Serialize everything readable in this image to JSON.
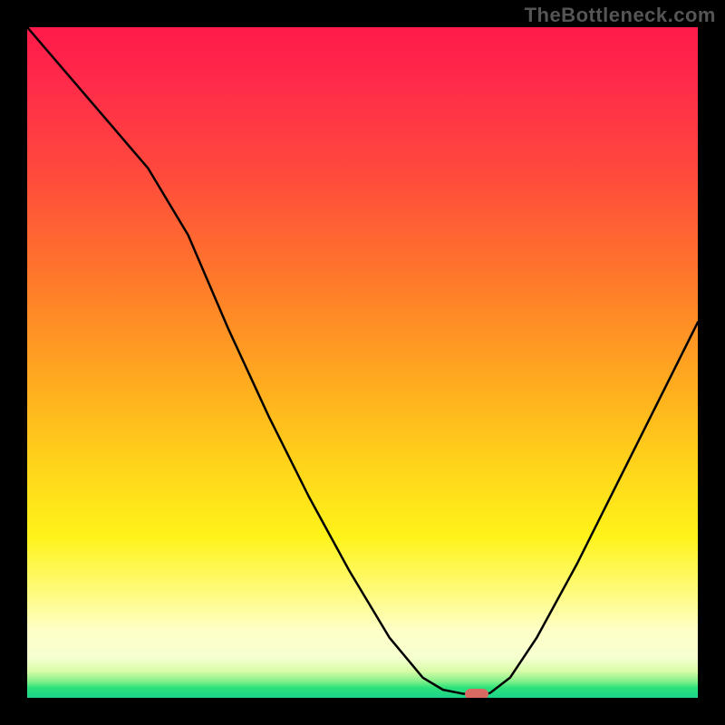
{
  "watermark": "TheBottleneck.com",
  "colors": {
    "frame": "#000000",
    "curve": "#000000",
    "marker": "#d86a62"
  },
  "chart_data": {
    "type": "line",
    "title": "",
    "xlabel": "",
    "ylabel": "",
    "xlim": [
      0,
      100
    ],
    "ylim": [
      0,
      100
    ],
    "x": [
      0,
      6,
      12,
      18,
      24,
      30,
      36,
      42,
      48,
      54,
      59,
      62,
      65,
      67.5,
      69,
      72,
      76,
      82,
      88,
      94,
      100
    ],
    "values": [
      100,
      93,
      86,
      79,
      69,
      55,
      42,
      30,
      19,
      9,
      3,
      1.2,
      0.6,
      0.5,
      0.7,
      3,
      9,
      20,
      32,
      44,
      56
    ],
    "minimum_x": 67,
    "color_scale_note": "vertical gradient background: red (high) → yellow (mid) → green (low)"
  }
}
